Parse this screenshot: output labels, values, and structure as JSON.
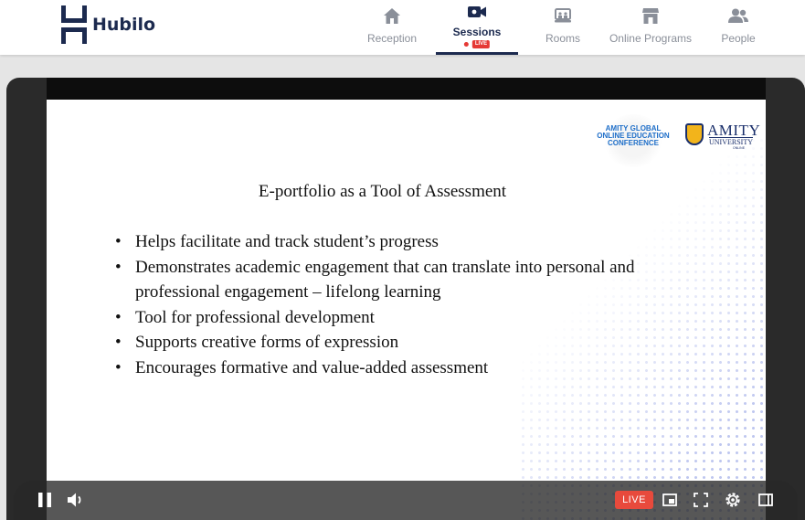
{
  "brand": {
    "name": "Hubilo",
    "color": "#1c2a4f"
  },
  "nav": {
    "items": [
      {
        "label": "Reception",
        "icon": "home-icon"
      },
      {
        "label": "Sessions",
        "icon": "video-camera-icon",
        "badge": "LIVE",
        "active": true
      },
      {
        "label": "Rooms",
        "icon": "rooms-icon"
      },
      {
        "label": "Online Programs",
        "icon": "storefront-icon"
      },
      {
        "label": "People",
        "icon": "people-icon"
      }
    ]
  },
  "slide": {
    "conference_logo": "AMITY GLOBAL ONLINE EDUCATION CONFERENCE",
    "university_name": "AMITY",
    "university_sub": "UNIVERSITY",
    "university_tag": "ONLINE",
    "title": "E-portfolio as a Tool of Assessment",
    "bullets": [
      "Helps facilitate and track student’s progress",
      "Demonstrates academic engagement that can translate into personal and professional engagement – lifelong learning",
      "Tool for professional development",
      "Supports creative forms of expression",
      "Encourages formative and value-added assessment"
    ]
  },
  "player": {
    "live_label": "LIVE",
    "live_color": "#e84a3c",
    "controls": [
      "pause-icon",
      "volume-icon",
      "miniplayer-icon",
      "fullscreen-icon",
      "settings-icon",
      "theater-mode-icon"
    ]
  }
}
